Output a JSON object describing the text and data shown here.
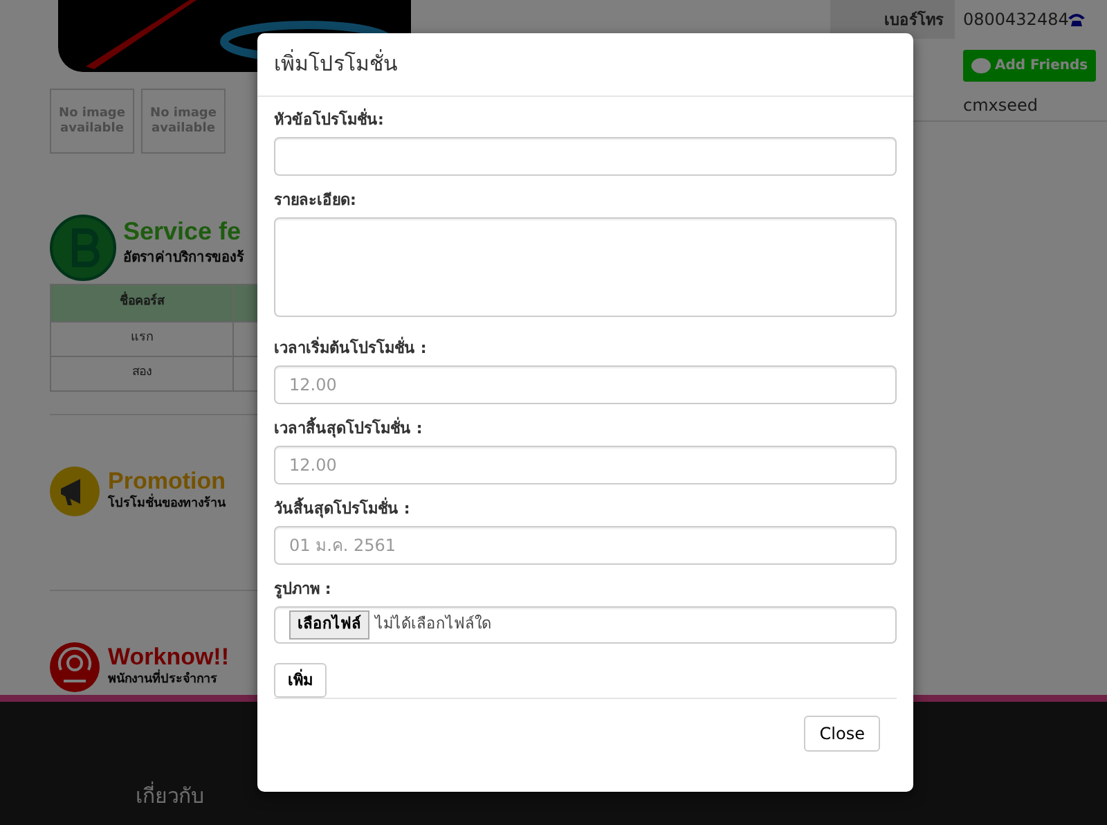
{
  "header": {
    "phone_label": "เบอร์โทร",
    "phone": "0800432484",
    "line_button": "Add Friends",
    "line_id": "cmxseed"
  },
  "thumbnails": [
    {
      "text": "No image available"
    },
    {
      "text": "No image available"
    }
  ],
  "service_fee": {
    "title": "Service fe",
    "subtitle": "อัตราค่าบริการของร้",
    "table": {
      "columns": [
        "ชื่อคอร์ส"
      ],
      "rows": [
        [
          "แรก"
        ],
        [
          "สอง"
        ]
      ]
    }
  },
  "sections": [
    {
      "kind": "promotion",
      "title": "Promotion",
      "subtitle": "โปรโมชั่นของทางร้าน"
    },
    {
      "kind": "worknow",
      "title": "Worknow!!",
      "subtitle": "พนักงานที่ประจำการ"
    }
  ],
  "footer": {
    "headings": [
      "เกี่ยวกับ"
    ]
  },
  "modal": {
    "title": "เพิ่มโปรโมชั่น",
    "fields": [
      {
        "kind": "text",
        "label": "หัวข้อโปรโมชั่น:"
      },
      {
        "kind": "textarea",
        "label": "รายละเอียด:"
      },
      {
        "kind": "text",
        "label": "เวลาเริ่มต้นโปรโมชั่น :",
        "placeholder": "12.00"
      },
      {
        "kind": "text",
        "label": "เวลาสิ้นสุดโปรโมชั่น :",
        "placeholder": "12.00"
      },
      {
        "kind": "text",
        "label": "วันสิ้นสุดโปรโมชั่น :",
        "placeholder": "01 ม.ค. 2561"
      },
      {
        "kind": "file",
        "label": "รูปภาพ :",
        "button": "เลือกไฟล์",
        "status": "ไม่ได้เลือกไฟล์ใด"
      }
    ],
    "submit": "เพิ่ม",
    "close": "Close"
  }
}
